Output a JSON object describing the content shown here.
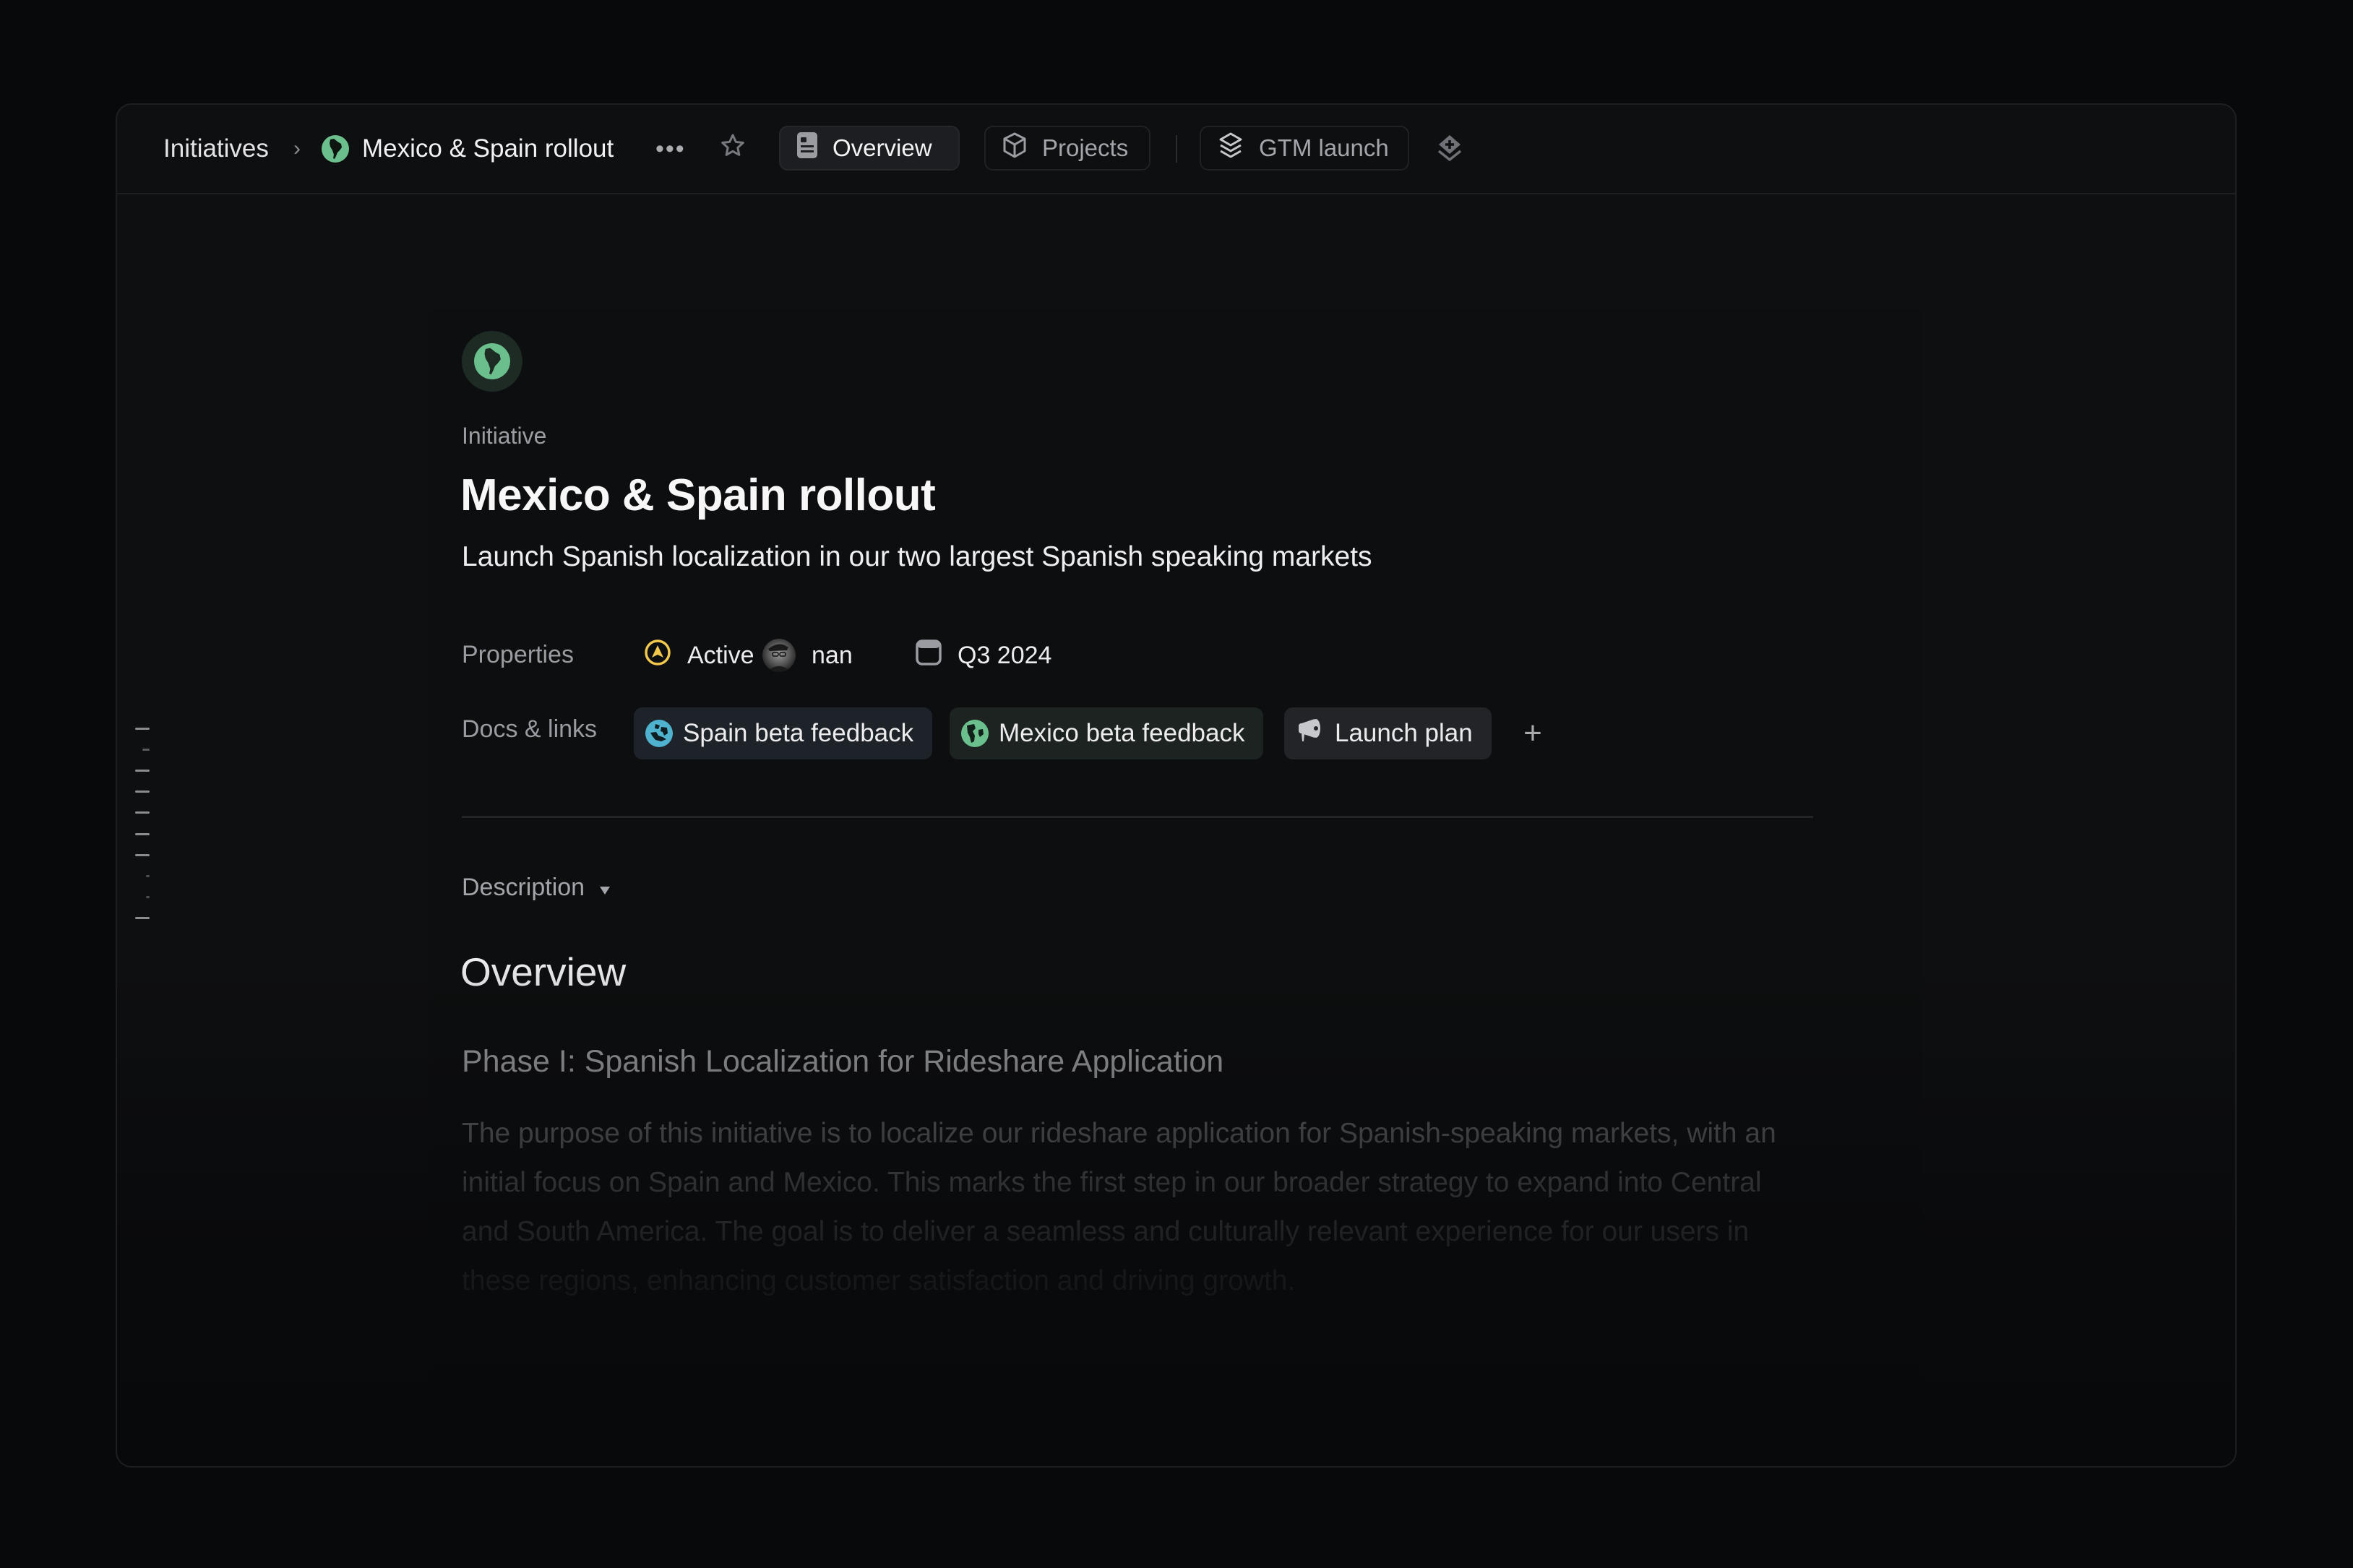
{
  "header": {
    "breadcrumb": {
      "root": "Initiatives",
      "separator": "›",
      "current": "Mexico & Spain rollout",
      "current_icon": "south-america-globe-icon"
    },
    "more_label": "•••",
    "star_icon": "star-icon",
    "tabs": [
      {
        "label": "Overview",
        "icon": "document-icon",
        "active": true
      },
      {
        "label": "Projects",
        "icon": "cube-icon",
        "active": false
      },
      {
        "label": "GTM launch",
        "icon": "layers-icon",
        "active": false
      }
    ],
    "add_view_icon": "layers-plus-icon"
  },
  "initiative": {
    "icon": "south-america-globe-icon",
    "icon_color": "#6abf8c",
    "type_label": "Initiative",
    "title": "Mexico & Spain rollout",
    "summary": "Launch Spanish localization in our two largest Spanish speaking markets",
    "properties": {
      "label": "Properties",
      "status": {
        "label": "Active",
        "icon": "status-active-icon",
        "color": "#f2c94c"
      },
      "lead": {
        "label": "nan",
        "icon": "avatar"
      },
      "target_date": {
        "label": "Q3 2024",
        "icon": "calendar-icon"
      }
    },
    "docs": {
      "label": "Docs & links",
      "items": [
        {
          "label": "Spain beta feedback",
          "icon": "europe-globe-icon",
          "color": "#4fb3d0"
        },
        {
          "label": "Mexico beta feedback",
          "icon": "americas-globe-icon",
          "color": "#6abf8c"
        },
        {
          "label": "Launch plan",
          "icon": "megaphone-icon",
          "color": "#c6c8cc"
        }
      ],
      "add_label": "+"
    }
  },
  "description": {
    "toggle_label": "Description",
    "toggle_icon": "caret-down-icon",
    "heading": "Overview",
    "subheading": "Phase I: Spanish Localization for Rideshare Application",
    "body_lines": [
      "The purpose of this initiative is to localize our rideshare application for Spanish-speaking markets, with an",
      "initial focus on Spain and Mexico. This marks the first step in our broader strategy to expand into Central",
      "and South America. The goal is to deliver a seamless and culturally relevant experience for our users in",
      "these regions, enhancing customer satisfaction and driving growth."
    ]
  }
}
